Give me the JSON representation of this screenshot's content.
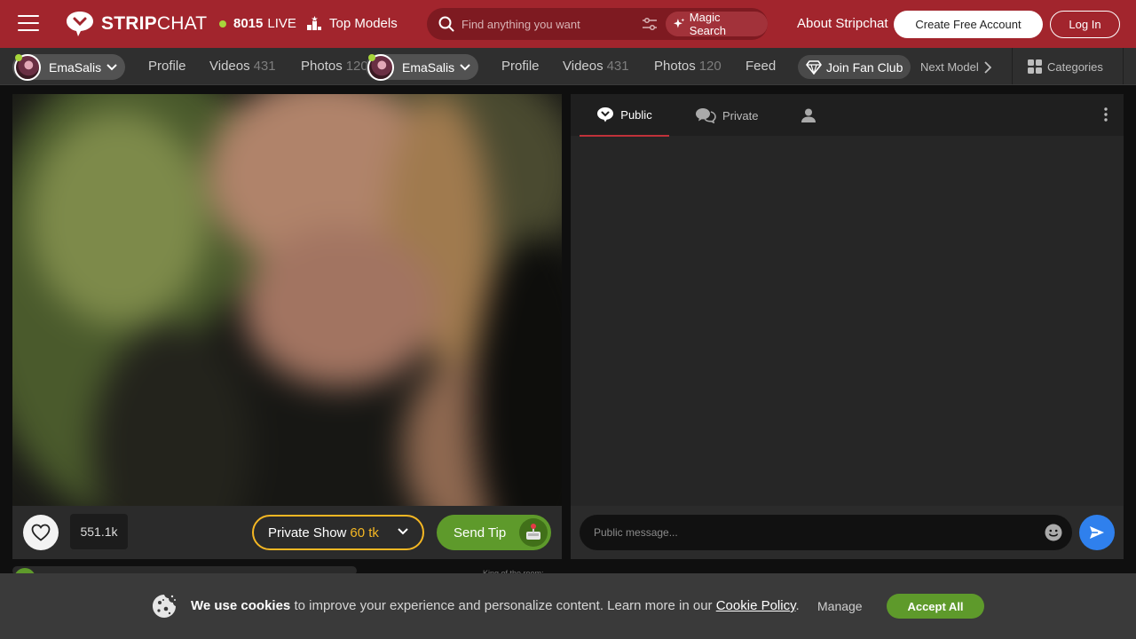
{
  "header": {
    "logo_bold": "STRIP",
    "logo_light": "CHAT",
    "live_count": "8015",
    "live_label": "LIVE",
    "top_models": "Top Models",
    "search_placeholder": "Find anything you want",
    "magic_search": "Magic Search",
    "about": "About Stripchat",
    "create_account": "Create Free Account",
    "login": "Log In",
    "brand_color": "#a2252d"
  },
  "subnav": {
    "model_a": "EmaSalis",
    "model_b": "EmaSalis",
    "left_links": [
      {
        "label": "Profile",
        "count": ""
      },
      {
        "label": "Videos",
        "count": "431"
      },
      {
        "label": "Photos",
        "count": "120"
      }
    ],
    "right_links": [
      {
        "label": "Profile",
        "count": ""
      },
      {
        "label": "Videos",
        "count": "431"
      },
      {
        "label": "Photos",
        "count": "120"
      },
      {
        "label": "Feed",
        "count": ""
      }
    ],
    "join_fan_club": "Join Fan Club",
    "next_model": "Next Model",
    "categories": "Categories"
  },
  "player": {
    "likes": "551.1k",
    "private_show": "Private Show",
    "private_price": "60 tk",
    "send_tip": "Send Tip"
  },
  "chat": {
    "tabs": [
      "Public",
      "Private"
    ],
    "active_tab": "Public",
    "input_placeholder": "Public message..."
  },
  "below": {
    "king_label": "King of the room:"
  },
  "cookie": {
    "lead": "We use cookies",
    "text": " to improve your experience and personalize content. Learn more in our ",
    "link": "Cookie Policy",
    "end": ".",
    "manage": "Manage",
    "accept": "Accept All",
    "accent_color": "#5e9a2b"
  }
}
